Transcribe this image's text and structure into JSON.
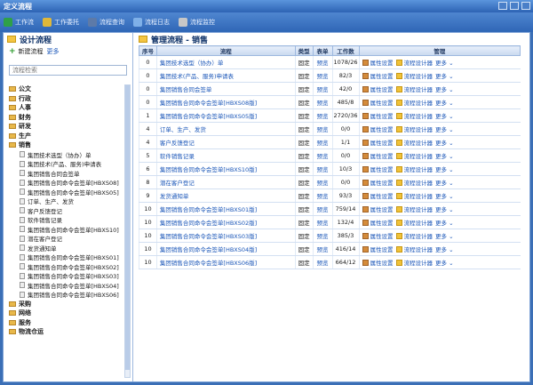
{
  "window": {
    "title": "定义流程"
  },
  "toolbar": {
    "items": [
      {
        "label": "工作流",
        "icon": "mail-icon",
        "color": "#2fa048"
      },
      {
        "label": "工作委托",
        "icon": "wand-icon",
        "color": "#e0b83a"
      },
      {
        "label": "流程查询",
        "icon": "table-icon",
        "color": "#5d7aa8"
      },
      {
        "label": "流程日志",
        "icon": "doc-icon",
        "color": "#7fb0e8"
      },
      {
        "label": "流程监控",
        "icon": "gear-icon",
        "color": "#c7c7c7"
      }
    ],
    "right_items": [
      {
        "label": "桌面",
        "icon": "user-icon"
      },
      {
        "label": "退出",
        "icon": "exit-icon"
      }
    ]
  },
  "left": {
    "title": "设计流程",
    "new_label": "新建流程",
    "more_label": "更多",
    "search_placeholder": "流程检索",
    "tree": [
      {
        "type": "folder",
        "label": "公文"
      },
      {
        "type": "folder",
        "label": "行政"
      },
      {
        "type": "folder",
        "label": "人事"
      },
      {
        "type": "folder",
        "label": "财务"
      },
      {
        "type": "folder",
        "label": "研发"
      },
      {
        "type": "folder",
        "label": "生产"
      },
      {
        "type": "folder",
        "label": "销售"
      },
      {
        "type": "leaf",
        "label": "集团技术选型（协办）单"
      },
      {
        "type": "leaf",
        "label": "集团技术(产品、服务)申请表"
      },
      {
        "type": "leaf",
        "label": "集团销售合同会签单"
      },
      {
        "type": "leaf",
        "label": "集团销售合同命令会签单[HBXS08]"
      },
      {
        "type": "leaf",
        "label": "集团销售合同命令会签单[HBXS05]"
      },
      {
        "type": "leaf",
        "label": "订单、生产、发货"
      },
      {
        "type": "leaf",
        "label": "客户反馈登记"
      },
      {
        "type": "leaf",
        "label": "软件销售记录"
      },
      {
        "type": "leaf",
        "label": "集团销售合同命令会签单[HBXS10]"
      },
      {
        "type": "leaf",
        "label": "潜在客户登记"
      },
      {
        "type": "leaf",
        "label": "发货通知单"
      },
      {
        "type": "leaf",
        "label": "集团销售合同命令会签单[HBXS01]"
      },
      {
        "type": "leaf",
        "label": "集团销售合同命令会签单[HBXS02]"
      },
      {
        "type": "leaf",
        "label": "集团销售合同命令会签单[HBXS03]"
      },
      {
        "type": "leaf",
        "label": "集团销售合同命令会签单[HBXS04]"
      },
      {
        "type": "leaf",
        "label": "集团销售合同命令会签单[HBXS06]"
      },
      {
        "type": "folder",
        "label": "采购"
      },
      {
        "type": "folder",
        "label": "网络"
      },
      {
        "type": "folder",
        "label": "服务"
      },
      {
        "type": "folder",
        "label": "物流仓运"
      }
    ]
  },
  "main": {
    "title": "管理流程 - 销售",
    "columns": [
      "序号",
      "流程",
      "类型",
      "表单",
      "工作数",
      "管理"
    ],
    "op_labels": {
      "edit": "属性设置",
      "design": "流程设计器",
      "more": "更多"
    },
    "rows": [
      {
        "seq": "0",
        "name": "集团技术选型（协办）单",
        "type": "固定",
        "form": "预览",
        "count": "1078/26"
      },
      {
        "seq": "0",
        "name": "集团技术(产品、服务)申请表",
        "type": "固定",
        "form": "预览",
        "count": "82/3"
      },
      {
        "seq": "0",
        "name": "集团销售合同会签单",
        "type": "固定",
        "form": "预览",
        "count": "42/0"
      },
      {
        "seq": "0",
        "name": "集团销售合同命令会签单[HBXS08版]",
        "type": "固定",
        "form": "预览",
        "count": "485/8"
      },
      {
        "seq": "1",
        "name": "集团销售合同命令会签单[HBXS05版]",
        "type": "固定",
        "form": "预览",
        "count": "2720/36"
      },
      {
        "seq": "4",
        "name": "订单、生产、发货",
        "type": "固定",
        "form": "预览",
        "count": "0/0"
      },
      {
        "seq": "4",
        "name": "客户反馈登记",
        "type": "固定",
        "form": "预览",
        "count": "1/1"
      },
      {
        "seq": "5",
        "name": "软件销售记录",
        "type": "固定",
        "form": "预览",
        "count": "0/0"
      },
      {
        "seq": "6",
        "name": "集团销售合同命令会签单[HBXS10版]",
        "type": "固定",
        "form": "预览",
        "count": "10/3"
      },
      {
        "seq": "8",
        "name": "潜在客户登记",
        "type": "固定",
        "form": "预览",
        "count": "0/0"
      },
      {
        "seq": "9",
        "name": "发货通知单",
        "type": "固定",
        "form": "预览",
        "count": "93/3"
      },
      {
        "seq": "10",
        "name": "集团销售合同命令会签单[HBXS01版]",
        "type": "固定",
        "form": "预览",
        "count": "759/14"
      },
      {
        "seq": "10",
        "name": "集团销售合同命令会签单[HBXS02版]",
        "type": "固定",
        "form": "预览",
        "count": "132/4"
      },
      {
        "seq": "10",
        "name": "集团销售合同命令会签单[HBXS03版]",
        "type": "固定",
        "form": "预览",
        "count": "385/3"
      },
      {
        "seq": "10",
        "name": "集团销售合同命令会签单[HBXS04版]",
        "type": "固定",
        "form": "预览",
        "count": "416/14"
      },
      {
        "seq": "10",
        "name": "集团销售合同命令会签单[HBXS06版]",
        "type": "固定",
        "form": "预览",
        "count": "664/12"
      }
    ]
  }
}
